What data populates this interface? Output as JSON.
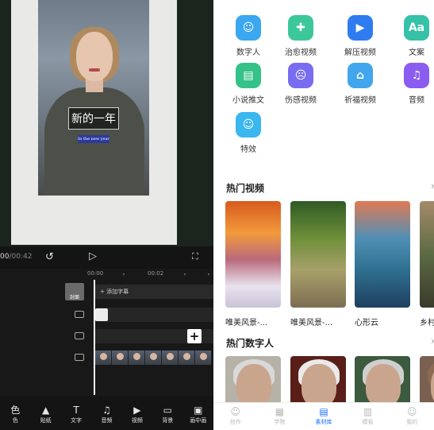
{
  "editor": {
    "caption": "新的一年",
    "caption_sub": "In the new year",
    "time_current": "00",
    "time_total": "/00:42",
    "ruler": [
      "00:00",
      "00:02"
    ],
    "cover_label": "封面",
    "add_subtitle": "+ 添加字幕",
    "add_btn": "+",
    "tools": [
      {
        "icon": "色",
        "label": "色"
      },
      {
        "icon": "▲",
        "label": "贴纸"
      },
      {
        "icon": "T",
        "label": "文字"
      },
      {
        "icon": "♫",
        "label": "音频"
      },
      {
        "icon": "▶",
        "label": "视频"
      },
      {
        "icon": "▭",
        "label": "背景"
      },
      {
        "icon": "▣",
        "label": "画中画"
      }
    ]
  },
  "library": {
    "categories": [
      {
        "label": "数字人",
        "icon": "person-icon",
        "glyph": "☺",
        "color": "#3aa7f0"
      },
      {
        "label": "治愈视频",
        "icon": "bandage-icon",
        "glyph": "✚",
        "color": "#3cc79a"
      },
      {
        "label": "解压视频",
        "icon": "play-icon",
        "glyph": "▶",
        "color": "#2f7cf0"
      },
      {
        "label": "文案",
        "icon": "text-icon",
        "glyph": "Aa",
        "color": "#35c2a8"
      },
      {
        "label": "小说推文",
        "icon": "book-icon",
        "glyph": "▤",
        "color": "#35c18a"
      },
      {
        "label": "伤感视频",
        "icon": "sad-face-icon",
        "glyph": "☹",
        "color": "#7a6cf0"
      },
      {
        "label": "祈福视频",
        "icon": "temple-icon",
        "glyph": "⌂",
        "color": "#42a6ee"
      },
      {
        "label": "音频",
        "icon": "music-icon",
        "glyph": "♫",
        "color": "#8a5cf0"
      },
      {
        "label": "特效",
        "icon": "effects-icon",
        "glyph": "☺",
        "color": "#3ab6f0"
      }
    ],
    "hot_videos_title": "热门视频",
    "more_glyph": "›",
    "videos": [
      {
        "label": "唯美风景-...",
        "bg": "linear-gradient(180deg,#d85a1e 0%,#f29a3c 30%,#b96a7c 55%,#e9e3ef 80%,#c9c4d6 100%)"
      },
      {
        "label": "唯美风景-...",
        "bg": "linear-gradient(180deg,#2f5a24 0%,#6f8f3a 35%,#a7a06a 65%,#7d6d52 100%)"
      },
      {
        "label": "心形云",
        "bg": "linear-gradient(180deg,#e07a55 0%,#4f8fb5 35%,#2f6f8f 65%,#1e4060 100%)"
      },
      {
        "label": "乡村",
        "bg": "linear-gradient(180deg,#a58a6a 0%,#5c6a44 50%,#3a3a2a 100%)"
      }
    ],
    "hot_digital_title": "热门数字人",
    "nav": [
      {
        "icon": "☺",
        "label": "创作",
        "active": false
      },
      {
        "icon": "▦",
        "label": "学院",
        "active": false
      },
      {
        "icon": "▤",
        "label": "素材库",
        "active": true
      },
      {
        "icon": "▥",
        "label": "模板",
        "active": false
      },
      {
        "icon": "☺",
        "label": "我的",
        "active": false
      }
    ]
  }
}
